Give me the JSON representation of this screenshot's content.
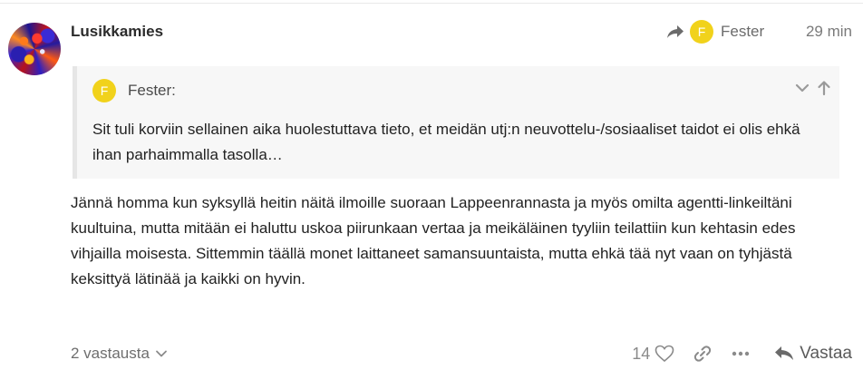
{
  "post": {
    "username": "Lusikkamies",
    "reply_to": {
      "initial": "F",
      "name": "Fester"
    },
    "time": "29 min",
    "quote": {
      "initial": "F",
      "author": "Fester:",
      "text": "Sit tuli korviin sellainen aika huolestuttava tieto, et meidän utj:n neuvottelu-/sosiaaliset taidot ei olis ehkä ihan parhaimmalla tasolla…"
    },
    "body": "Jännä homma kun syksyllä heitin näitä ilmoille suoraan Lappeenrannasta ja myös omilta agentti-linkeiltäni kuultuina, mutta mitään ei haluttu uskoa piirunkaan vertaa ja meikäläinen tyyliin teilattiin kun kehtasin edes vihjailla moisesta. Sittemmin täällä monet laittaneet samansuuntaista, mutta ehkä tää nyt vaan on tyhjästä keksittyä lätinää ja kaikki on hyvin."
  },
  "footer": {
    "replies_label": "2 vastausta",
    "like_count": "14",
    "reply_label": "Vastaa"
  },
  "colors": {
    "avatar_yellow": "#f1d21b",
    "quote_bg": "#f7f7f7",
    "quote_border": "#e6e6e6"
  }
}
